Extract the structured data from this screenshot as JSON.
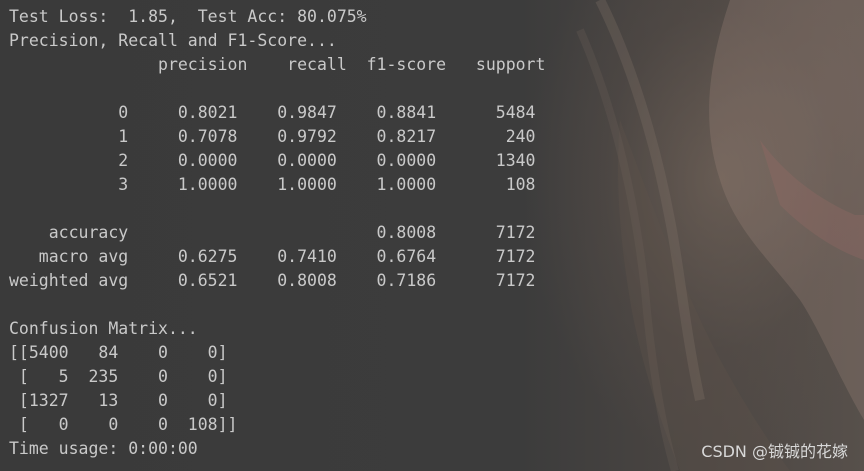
{
  "terminal": {
    "partial_top_line": "— — -— -— -— — -— -— -— -— -—",
    "lines": [
      "Test Loss:  1.85,  Test Acc: 80.075%",
      "Precision, Recall and F1-Score...",
      "               precision    recall  f1-score   support",
      "",
      "           0     0.8021    0.9847    0.8841      5484",
      "           1     0.7078    0.9792    0.8217       240",
      "           2     0.0000    0.0000    0.0000      1340",
      "           3     1.0000    1.0000    1.0000       108",
      "",
      "    accuracy                         0.8008      7172",
      "   macro avg     0.6275    0.7410    0.6764      7172",
      "weighted avg     0.6521    0.8008    0.7186      7172",
      "",
      "Confusion Matrix...",
      "[[5400   84    0    0]",
      " [   5  235    0    0]",
      " [1327   13    0    0]",
      " [   0    0    0  108]]",
      "Time usage: 0:00:00"
    ]
  },
  "watermark": {
    "text": "CSDN @铖铖的花嫁"
  }
}
